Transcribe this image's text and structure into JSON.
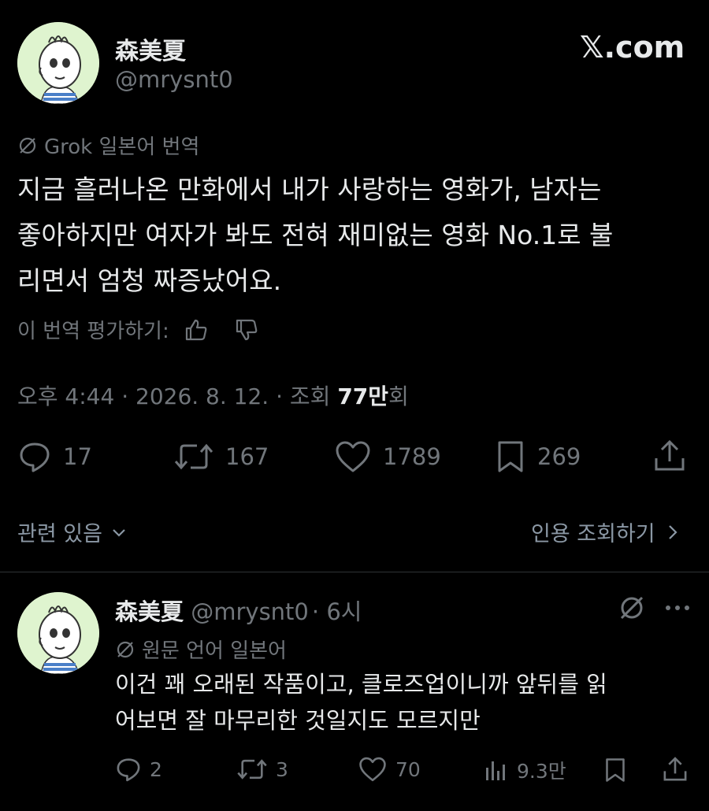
{
  "brand": {
    "logo_text": "𝕏.com"
  },
  "post": {
    "author": {
      "name": "森美夏",
      "handle": "@mrysnt0"
    },
    "translation_label": "Grok 일본어 번역",
    "text_lines": [
      "지금 흘러나온 만화에서 내가 사랑하는 영화가, 남자는",
      "좋아하지만 여자가 봐도 전혀 재미없는 영화 No.1로 불",
      "리면서 엄청 짜증났어요."
    ],
    "rate_translation_label": "이 번역 평가하기:",
    "meta": {
      "time_date": "오후 4:44 · 2026. 8. 12. · 조회 ",
      "views": "77만",
      "views_suffix": "회"
    },
    "actions": {
      "reply_count": "17",
      "repost_count": "167",
      "like_count": "1789",
      "bookmark_count": "269"
    },
    "related_label": "관련 있음",
    "quotes_label": "인용 조회하기"
  },
  "reply": {
    "author": {
      "name": "森美夏",
      "handle": "@mrysnt0",
      "time": "· 6시"
    },
    "original_language_label": "원문 언어 일본어",
    "text_lines": [
      "이건 꽤 오래된 작품이고, 클로즈업이니까 앞뒤를 읽",
      "어보면 잘 마무리한 것일지도 모르지만"
    ],
    "actions": {
      "reply_count": "2",
      "repost_count": "3",
      "like_count": "70",
      "views_count": "9.3만"
    }
  },
  "colors": {
    "background": "#000000",
    "text": "#e7e9ea",
    "muted": "#71767b",
    "divider": "#2f3336",
    "avatar_bg": "#dff4cf"
  }
}
